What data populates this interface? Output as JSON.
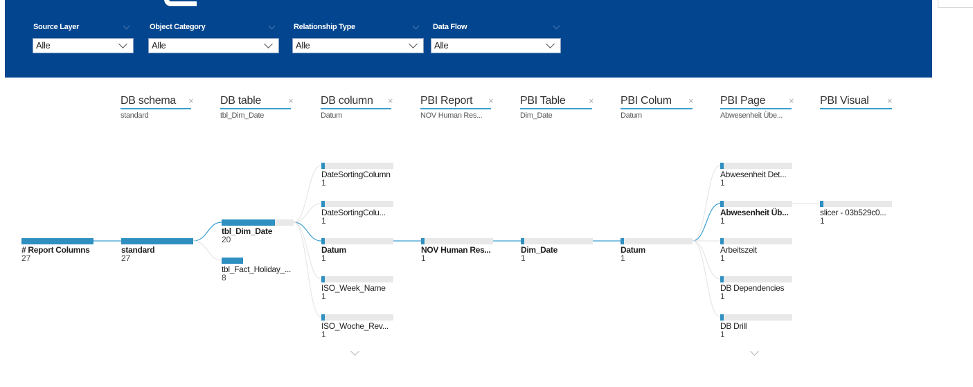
{
  "colors": {
    "header": "#03468f",
    "accent": "#2e8fc0",
    "underline": "#3a9fd0"
  },
  "filters": [
    {
      "label": "Source Layer",
      "value": "Alle"
    },
    {
      "label": "Object Category",
      "value": "Alle"
    },
    {
      "label": "Relationship Type",
      "value": "Alle"
    },
    {
      "label": "Data Flow",
      "value": "Alle"
    }
  ],
  "levels": [
    {
      "label": "DB schema",
      "value": "standard",
      "close": "×"
    },
    {
      "label": "DB table",
      "value": "tbl_Dim_Date",
      "close": "×"
    },
    {
      "label": "DB column",
      "value": "Datum",
      "close": "×"
    },
    {
      "label": "PBI Report",
      "value": "NOV Human Res...",
      "close": "×"
    },
    {
      "label": "PBI Table",
      "value": "Dim_Date",
      "close": "×"
    },
    {
      "label": "PBI Colum",
      "value": "Datum",
      "close": "×"
    },
    {
      "label": "PBI Page",
      "value": "Abwesenheit Übe...",
      "close": "×"
    },
    {
      "label": "PBI Visual",
      "value": "",
      "close": "×"
    }
  ],
  "tree": {
    "root": {
      "label": "# Report Columns",
      "count": "27",
      "fill": 1.0
    },
    "schema": [
      {
        "label": "standard",
        "count": "27",
        "fill": 1.0,
        "selected": true
      }
    ],
    "table": [
      {
        "label": "tbl_Dim_Date",
        "count": "20",
        "fill": 0.74,
        "selected": true
      },
      {
        "label": "tbl_Fact_Holiday_...",
        "count": "8",
        "fill": 0.3,
        "selected": false
      }
    ],
    "column": [
      {
        "label": "DateSortingColumn",
        "count": "1",
        "fill": 0.05,
        "selected": false
      },
      {
        "label": "DateSortingColu...",
        "count": "1",
        "fill": 0.05,
        "selected": false
      },
      {
        "label": "Datum",
        "count": "1",
        "fill": 0.05,
        "selected": true
      },
      {
        "label": "ISO_Week_Name",
        "count": "1",
        "fill": 0.05,
        "selected": false
      },
      {
        "label": "ISO_Woche_Rev...",
        "count": "1",
        "fill": 0.05,
        "selected": false
      }
    ],
    "report": [
      {
        "label": "NOV Human Res...",
        "count": "1",
        "fill": 0.05,
        "selected": true
      }
    ],
    "pbi_table": [
      {
        "label": "Dim_Date",
        "count": "1",
        "fill": 0.05,
        "selected": true
      }
    ],
    "pbi_column": [
      {
        "label": "Datum",
        "count": "1",
        "fill": 0.05,
        "selected": true
      }
    ],
    "page": [
      {
        "label": "Abwesenheit Det...",
        "count": "1",
        "fill": 0.05,
        "selected": false
      },
      {
        "label": "Abwesenheit Üb...",
        "count": "1",
        "fill": 0.05,
        "selected": true
      },
      {
        "label": "Arbeitszeit",
        "count": "1",
        "fill": 0.05,
        "selected": false
      },
      {
        "label": "DB Dependencies",
        "count": "1",
        "fill": 0.05,
        "selected": false
      },
      {
        "label": "DB Drill",
        "count": "1",
        "fill": 0.05,
        "selected": false
      }
    ],
    "visual": [
      {
        "label": "slicer - 03b529c0...",
        "count": "1",
        "fill": 0.05,
        "selected": false
      }
    ]
  }
}
